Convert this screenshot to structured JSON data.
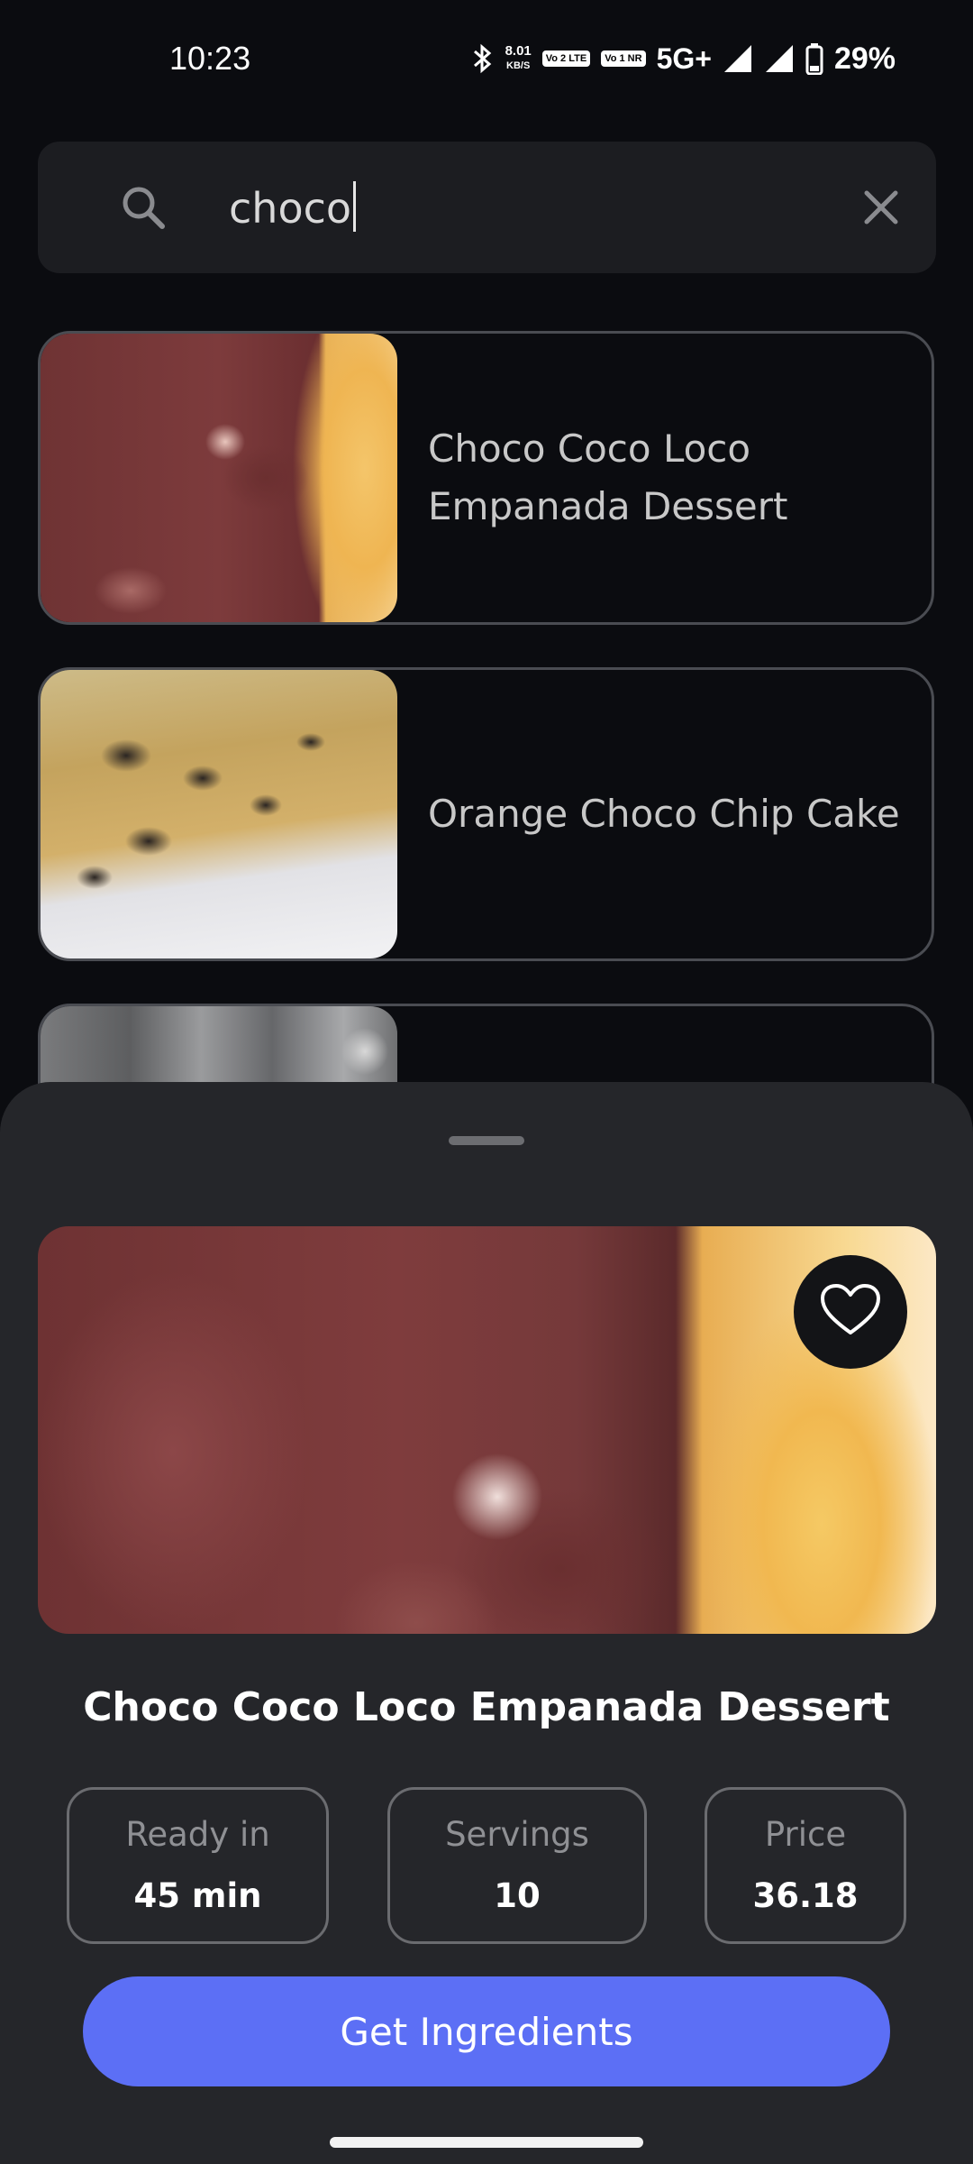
{
  "status_bar": {
    "time": "10:23",
    "speed_value": "8.01",
    "speed_unit": "KB/S",
    "sim1_badge": "Vo 2 LTE",
    "sim2_badge": "Vo 1 NR",
    "network": "5G+",
    "battery": "29%"
  },
  "search": {
    "query": "choco",
    "icon": "search-icon",
    "clear_icon": "close-icon"
  },
  "results": [
    {
      "title": "Choco Coco Loco Empanada Dessert"
    },
    {
      "title": "Orange Choco Chip Cake"
    },
    {
      "title": ""
    }
  ],
  "detail": {
    "title": "Choco Coco Loco Empanada Dessert",
    "favorite_icon": "heart-outline-icon",
    "ready_in_label": "Ready in",
    "ready_in_value": "45 min",
    "servings_label": "Servings",
    "servings_value": "10",
    "price_label": "Price",
    "price_value": "36.18",
    "cta_label": "Get Ingredients"
  },
  "colors": {
    "background": "#0b0c10",
    "sheet": "#25262a",
    "accent": "#5c6ff5"
  }
}
